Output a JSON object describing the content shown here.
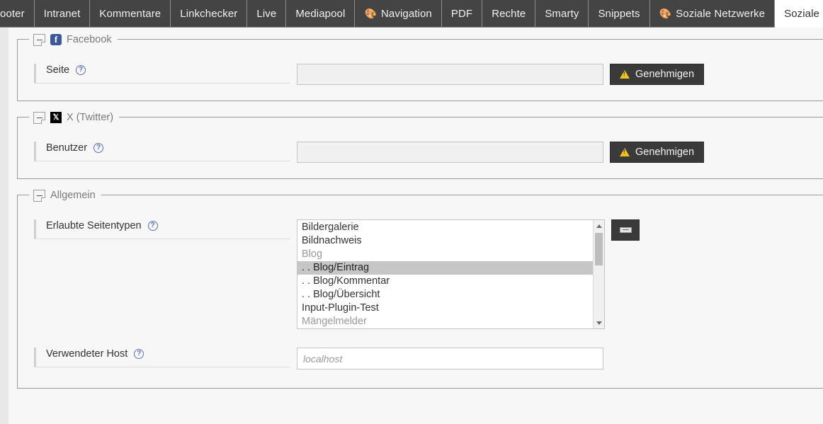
{
  "tabbar": {
    "scroll_left_icon": "chevron-left-icon",
    "tabs": [
      {
        "label": "ooter",
        "icon": "",
        "active": false,
        "clipped": true
      },
      {
        "label": "Intranet",
        "icon": "",
        "active": false
      },
      {
        "label": "Kommentare",
        "icon": "",
        "active": false
      },
      {
        "label": "Linkchecker",
        "icon": "",
        "active": false
      },
      {
        "label": "Live",
        "icon": "",
        "active": false
      },
      {
        "label": "Mediapool",
        "icon": "",
        "active": false
      },
      {
        "label": "Navigation",
        "icon": "🎨",
        "active": false
      },
      {
        "label": "PDF",
        "icon": "",
        "active": false
      },
      {
        "label": "Rechte",
        "icon": "",
        "active": false
      },
      {
        "label": "Smarty",
        "icon": "",
        "active": false
      },
      {
        "label": "Snippets",
        "icon": "",
        "active": false
      },
      {
        "label": "Soziale Netzwerke",
        "icon": "🎨",
        "active": false
      },
      {
        "label": "Soziale Netzwerke",
        "icon": "",
        "active": true
      }
    ]
  },
  "sections": {
    "facebook": {
      "legend": "Facebook",
      "logo_text": "f",
      "field_label": "Seite",
      "help_char": "?",
      "input_value": "",
      "input_placeholder": "",
      "button_label": "Genehmigen"
    },
    "twitter": {
      "legend": "X (Twitter)",
      "logo_text": "𝕏",
      "field_label": "Benutzer",
      "help_char": "?",
      "input_value": "",
      "input_placeholder": "",
      "button_label": "Genehmigen"
    },
    "allgemein": {
      "legend": "Allgemein",
      "pagetypes_label": "Erlaubte Seitentypen",
      "help_char": "?",
      "options": [
        {
          "label": "Bildergalerie",
          "state": "normal"
        },
        {
          "label": "Bildnachweis",
          "state": "normal"
        },
        {
          "label": "Blog",
          "state": "disabled"
        },
        {
          "label": ". . Blog/Eintrag",
          "state": "selected"
        },
        {
          "label": ". . Blog/Kommentar",
          "state": "normal"
        },
        {
          "label": ". . Blog/Übersicht",
          "state": "normal"
        },
        {
          "label": "Input-Plugin-Test",
          "state": "normal"
        },
        {
          "label": "Mängelmelder",
          "state": "disabled"
        }
      ],
      "remove_button_label": "−",
      "host_label": "Verwendeter Host",
      "host_value": "",
      "host_placeholder": "localhost"
    }
  },
  "colors": {
    "tab_inactive_bg": "#444444",
    "tab_active_bg": "#ffffff",
    "page_bg": "#e8e8e8",
    "panel_bg": "#f7f7f7",
    "button_dark": "#3a3a3a",
    "warning_yellow": "#f0c020",
    "facebook_blue": "#3b5998",
    "help_blue": "#5b6fb8",
    "selection_grey": "#c6c6c6"
  }
}
